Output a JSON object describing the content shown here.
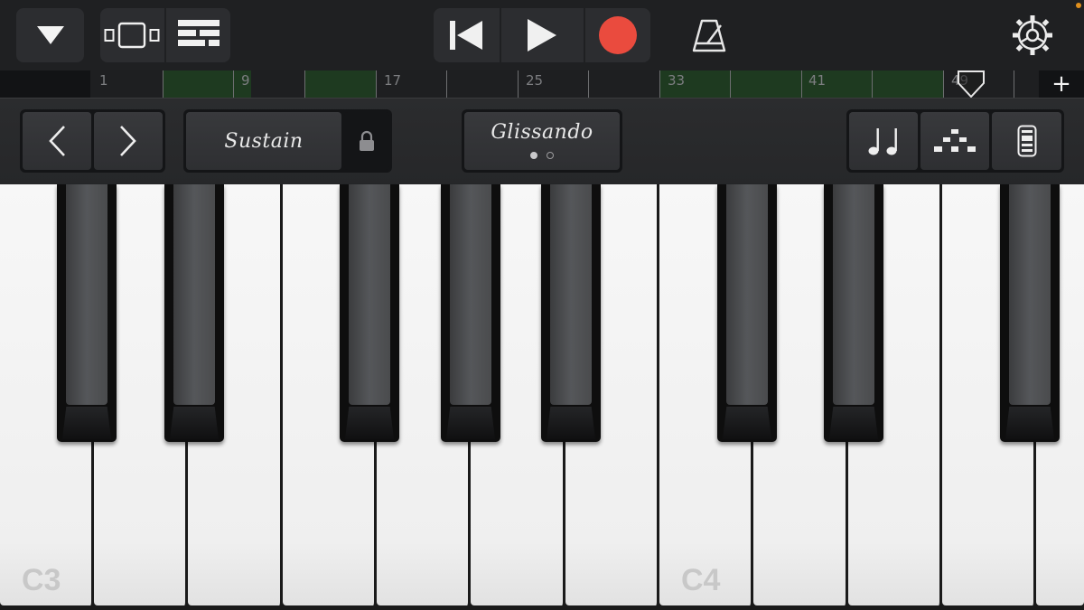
{
  "toolbar": {
    "buttons": [
      {
        "name": "tracks-menu",
        "icon": "triangle-down-icon"
      },
      {
        "name": "view-toggle",
        "icon": "instrument-view-icon"
      },
      {
        "name": "tracks-view",
        "icon": "tracks-list-icon"
      },
      {
        "name": "go-to-start",
        "icon": "skip-back-icon"
      },
      {
        "name": "play",
        "icon": "play-icon"
      },
      {
        "name": "record",
        "icon": "record-icon"
      },
      {
        "name": "metronome",
        "icon": "metronome-icon"
      },
      {
        "name": "settings",
        "icon": "gear-icon"
      }
    ],
    "record_color": "#ea4b3e",
    "status_dot_color": "#e08f1c"
  },
  "ruler": {
    "bar_numbers": [
      "1",
      "9",
      "17",
      "25",
      "33",
      "41",
      "49"
    ],
    "add_label": "+"
  },
  "controls": {
    "octave_down_icon": "chevron-left-icon",
    "octave_up_icon": "chevron-right-icon",
    "sustain_label": "Sustain",
    "sustain_lock_icon": "lock-icon",
    "glissando_label": "Glissando",
    "glissando_page": 1,
    "glissando_page_count": 2,
    "arpeggiator_icon": "notes-icon",
    "scale_icon": "scale-icon",
    "velocity_icon": "velocity-icon"
  },
  "keyboard": {
    "white_key_count": 12,
    "octave_labels": [
      "C3",
      "C4"
    ]
  }
}
